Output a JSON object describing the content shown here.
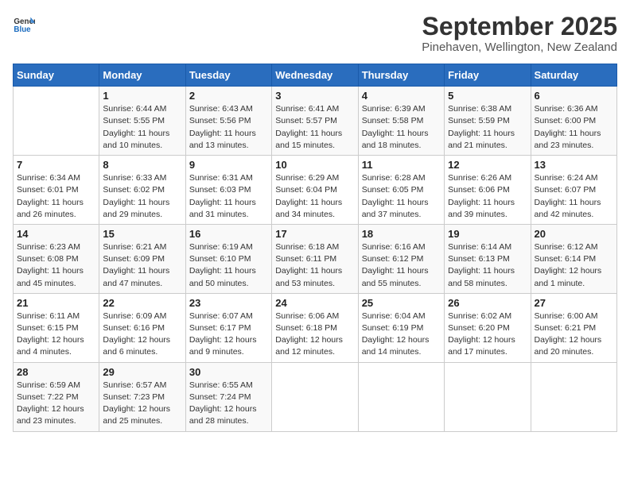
{
  "logo": {
    "general": "General",
    "blue": "Blue"
  },
  "title": "September 2025",
  "subtitle": "Pinehaven, Wellington, New Zealand",
  "days_of_week": [
    "Sunday",
    "Monday",
    "Tuesday",
    "Wednesday",
    "Thursday",
    "Friday",
    "Saturday"
  ],
  "weeks": [
    [
      {
        "day": "",
        "info": ""
      },
      {
        "day": "1",
        "info": "Sunrise: 6:44 AM\nSunset: 5:55 PM\nDaylight: 11 hours\nand 10 minutes."
      },
      {
        "day": "2",
        "info": "Sunrise: 6:43 AM\nSunset: 5:56 PM\nDaylight: 11 hours\nand 13 minutes."
      },
      {
        "day": "3",
        "info": "Sunrise: 6:41 AM\nSunset: 5:57 PM\nDaylight: 11 hours\nand 15 minutes."
      },
      {
        "day": "4",
        "info": "Sunrise: 6:39 AM\nSunset: 5:58 PM\nDaylight: 11 hours\nand 18 minutes."
      },
      {
        "day": "5",
        "info": "Sunrise: 6:38 AM\nSunset: 5:59 PM\nDaylight: 11 hours\nand 21 minutes."
      },
      {
        "day": "6",
        "info": "Sunrise: 6:36 AM\nSunset: 6:00 PM\nDaylight: 11 hours\nand 23 minutes."
      }
    ],
    [
      {
        "day": "7",
        "info": "Sunrise: 6:34 AM\nSunset: 6:01 PM\nDaylight: 11 hours\nand 26 minutes."
      },
      {
        "day": "8",
        "info": "Sunrise: 6:33 AM\nSunset: 6:02 PM\nDaylight: 11 hours\nand 29 minutes."
      },
      {
        "day": "9",
        "info": "Sunrise: 6:31 AM\nSunset: 6:03 PM\nDaylight: 11 hours\nand 31 minutes."
      },
      {
        "day": "10",
        "info": "Sunrise: 6:29 AM\nSunset: 6:04 PM\nDaylight: 11 hours\nand 34 minutes."
      },
      {
        "day": "11",
        "info": "Sunrise: 6:28 AM\nSunset: 6:05 PM\nDaylight: 11 hours\nand 37 minutes."
      },
      {
        "day": "12",
        "info": "Sunrise: 6:26 AM\nSunset: 6:06 PM\nDaylight: 11 hours\nand 39 minutes."
      },
      {
        "day": "13",
        "info": "Sunrise: 6:24 AM\nSunset: 6:07 PM\nDaylight: 11 hours\nand 42 minutes."
      }
    ],
    [
      {
        "day": "14",
        "info": "Sunrise: 6:23 AM\nSunset: 6:08 PM\nDaylight: 11 hours\nand 45 minutes."
      },
      {
        "day": "15",
        "info": "Sunrise: 6:21 AM\nSunset: 6:09 PM\nDaylight: 11 hours\nand 47 minutes."
      },
      {
        "day": "16",
        "info": "Sunrise: 6:19 AM\nSunset: 6:10 PM\nDaylight: 11 hours\nand 50 minutes."
      },
      {
        "day": "17",
        "info": "Sunrise: 6:18 AM\nSunset: 6:11 PM\nDaylight: 11 hours\nand 53 minutes."
      },
      {
        "day": "18",
        "info": "Sunrise: 6:16 AM\nSunset: 6:12 PM\nDaylight: 11 hours\nand 55 minutes."
      },
      {
        "day": "19",
        "info": "Sunrise: 6:14 AM\nSunset: 6:13 PM\nDaylight: 11 hours\nand 58 minutes."
      },
      {
        "day": "20",
        "info": "Sunrise: 6:12 AM\nSunset: 6:14 PM\nDaylight: 12 hours\nand 1 minute."
      }
    ],
    [
      {
        "day": "21",
        "info": "Sunrise: 6:11 AM\nSunset: 6:15 PM\nDaylight: 12 hours\nand 4 minutes."
      },
      {
        "day": "22",
        "info": "Sunrise: 6:09 AM\nSunset: 6:16 PM\nDaylight: 12 hours\nand 6 minutes."
      },
      {
        "day": "23",
        "info": "Sunrise: 6:07 AM\nSunset: 6:17 PM\nDaylight: 12 hours\nand 9 minutes."
      },
      {
        "day": "24",
        "info": "Sunrise: 6:06 AM\nSunset: 6:18 PM\nDaylight: 12 hours\nand 12 minutes."
      },
      {
        "day": "25",
        "info": "Sunrise: 6:04 AM\nSunset: 6:19 PM\nDaylight: 12 hours\nand 14 minutes."
      },
      {
        "day": "26",
        "info": "Sunrise: 6:02 AM\nSunset: 6:20 PM\nDaylight: 12 hours\nand 17 minutes."
      },
      {
        "day": "27",
        "info": "Sunrise: 6:00 AM\nSunset: 6:21 PM\nDaylight: 12 hours\nand 20 minutes."
      }
    ],
    [
      {
        "day": "28",
        "info": "Sunrise: 6:59 AM\nSunset: 7:22 PM\nDaylight: 12 hours\nand 23 minutes."
      },
      {
        "day": "29",
        "info": "Sunrise: 6:57 AM\nSunset: 7:23 PM\nDaylight: 12 hours\nand 25 minutes."
      },
      {
        "day": "30",
        "info": "Sunrise: 6:55 AM\nSunset: 7:24 PM\nDaylight: 12 hours\nand 28 minutes."
      },
      {
        "day": "",
        "info": ""
      },
      {
        "day": "",
        "info": ""
      },
      {
        "day": "",
        "info": ""
      },
      {
        "day": "",
        "info": ""
      }
    ]
  ]
}
